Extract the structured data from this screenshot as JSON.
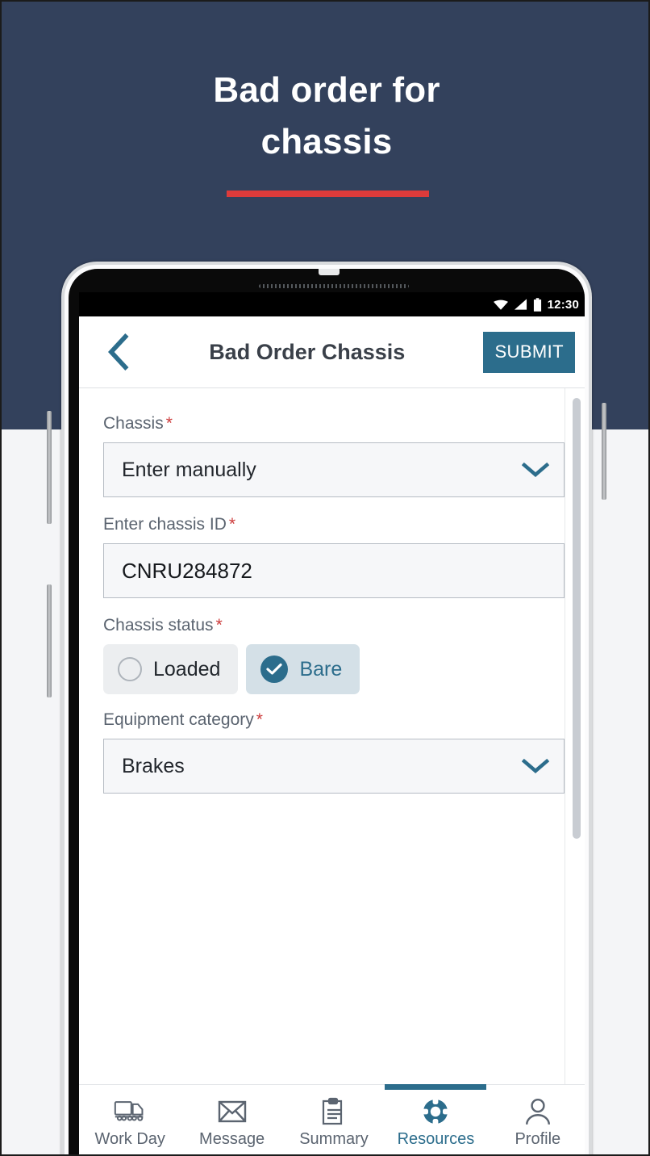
{
  "hero": {
    "title": "Bad order for\nchassis",
    "accent_color": "#dd3b3b",
    "background_color": "#33415c"
  },
  "theme": {
    "primary": "#2c6d8c",
    "required_asterisk": "#cc3c3c",
    "label_text": "#5b6470"
  },
  "phone": {
    "status_bar": {
      "time": "12:30",
      "icons": [
        "wifi-icon",
        "cell-signal-icon",
        "battery-icon"
      ]
    },
    "app_bar": {
      "back_icon": "chevron-left-icon",
      "title": "Bad Order Chassis",
      "submit_label": "SUBMIT"
    },
    "form": {
      "fields": [
        {
          "label": "Chassis",
          "required": "*",
          "type": "select",
          "value": "Enter manually"
        },
        {
          "label": "Enter chassis ID",
          "required": "*",
          "type": "text",
          "value": "CNRU284872",
          "placeholder": "Enter chassis ID"
        },
        {
          "label": "Chassis status",
          "required": "*",
          "type": "radio-chips",
          "options": [
            {
              "label": "Loaded",
              "selected": false
            },
            {
              "label": "Bare",
              "selected": true
            }
          ]
        },
        {
          "label": "Equipment category",
          "required": "*",
          "type": "select",
          "value": "Brakes"
        }
      ]
    },
    "bottom_nav": {
      "items": [
        {
          "label": "Work Day",
          "icon": "truck-icon",
          "active": false
        },
        {
          "label": "Message",
          "icon": "envelope-icon",
          "active": false
        },
        {
          "label": "Summary",
          "icon": "clipboard-icon",
          "active": false
        },
        {
          "label": "Resources",
          "icon": "life-ring-icon",
          "active": true
        },
        {
          "label": "Profile",
          "icon": "person-icon",
          "active": false
        }
      ]
    }
  }
}
